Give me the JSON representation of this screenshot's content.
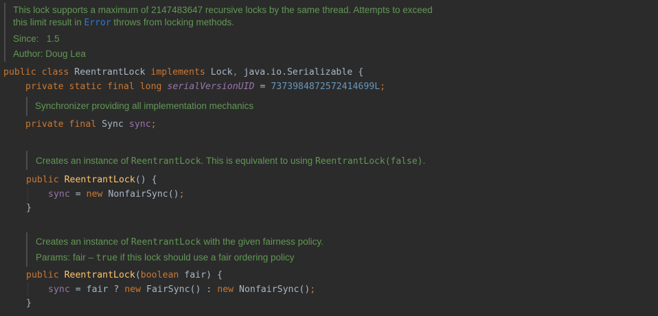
{
  "class_doc": {
    "line1": "This lock supports a maximum of 2147483647 recursive locks by the same thread. Attempts to exceed",
    "line2_pre": "this limit result in ",
    "line2_link": "Error",
    "line2_post": " throws from locking methods.",
    "since_label": "Since:",
    "since_value": "1.5",
    "author_label": "Author:",
    "author_value": "Doug Lea"
  },
  "class_decl": {
    "kw_public": "public",
    "kw_class": "class",
    "name": "ReentrantLock",
    "kw_implements": "implements",
    "iface1": "Lock",
    "iface2": "java.io.Serializable",
    "open_brace": "{"
  },
  "serial_field": {
    "modifiers": "private static final long",
    "name": "serialVersionUID",
    "equals": "=",
    "value": "7373984872572414699L",
    "semi": ";"
  },
  "sync_doc": "Synchronizer providing all implementation mechanics",
  "sync_field": {
    "modifiers": "private final",
    "type": "Sync",
    "name": "sync",
    "semi": ";"
  },
  "ctor1_doc": {
    "pre": "Creates an instance of ",
    "code1": "ReentrantLock",
    "mid": ". This is equivalent to using ",
    "code2": "ReentrantLock(false)",
    "post": "."
  },
  "ctor1": {
    "kw_public": "public",
    "name": "ReentrantLock",
    "sig": "() {",
    "body_field": "sync",
    "body_eq": "=",
    "body_new": "new",
    "body_call": "NonfairSync()",
    "body_semi": ";",
    "close": "}"
  },
  "ctor2_doc": {
    "pre": "Creates an instance of ",
    "code1": "ReentrantLock",
    "post": " with the given fairness policy.",
    "params_label": "Params:",
    "params_pre": " fair – ",
    "params_code": "true",
    "params_post": " if this lock should use a fair ordering policy"
  },
  "ctor2": {
    "kw_public": "public",
    "name": "ReentrantLock",
    "paren_open": "(",
    "param_type": "boolean",
    "param_name": "fair",
    "sig_end": ") {",
    "body_field": "sync",
    "body_eq": "=",
    "body_cond": "fair ?",
    "body_new1": "new",
    "body_call1": "FairSync()",
    "body_colon": ":",
    "body_new2": "new",
    "body_call2": "NonfairSync()",
    "body_semi": ";",
    "close": "}"
  },
  "colors": {
    "background": "#2b2b2b",
    "keyword": "#cc7832",
    "doc_text": "#629755",
    "field": "#9876aa",
    "number": "#6897bb",
    "method": "#ffc66d",
    "link": "#287bde"
  }
}
